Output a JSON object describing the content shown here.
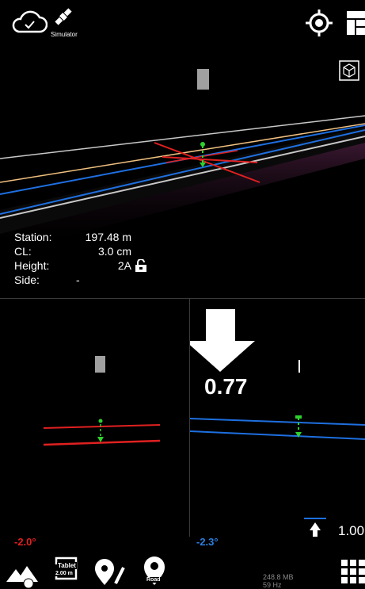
{
  "topbar": {
    "simulator_label": "Simulator"
  },
  "info": {
    "station_label": "Station:",
    "station_value": "197.48 m",
    "cl_label": "CL:",
    "cl_value": "3.0 cm",
    "height_label": "Height:",
    "height_value": "2A",
    "side_label": "Side:",
    "side_value": "-"
  },
  "left_panel": {
    "angle": "-2.0°",
    "angle_color": "#e02020"
  },
  "right_panel": {
    "value": "0.77",
    "angle": "-2.3°",
    "angle_color": "#2d7fe0",
    "offset_value": "1.00"
  },
  "bottombar": {
    "tablet_label": "Tablet",
    "tablet_value": "2.00 m",
    "road_label": "Road",
    "memory": "248.8 MB",
    "refresh": "59 Hz"
  },
  "colors": {
    "red": "#e02020",
    "blue": "#1e6fe0",
    "green": "#2ed12e",
    "orange": "#f0c080"
  },
  "icons": [
    "cloud-check-icon",
    "satellite-icon",
    "target-icon",
    "layout-icon",
    "cube-icon",
    "lock-open-icon",
    "down-arrow-icon",
    "up-arrow-icon",
    "terrain-icon",
    "tablet-icon",
    "location-edit-icon",
    "road-pin-icon",
    "grid-icon"
  ]
}
